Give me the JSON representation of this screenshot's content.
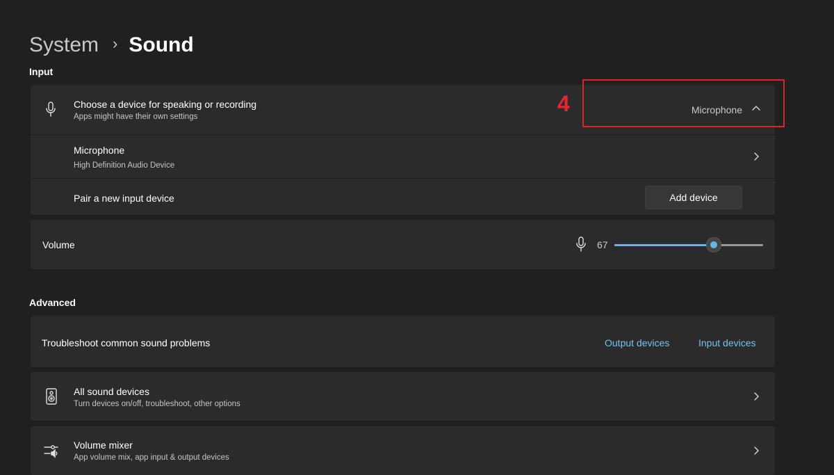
{
  "breadcrumb": {
    "parent": "System",
    "separator": "›",
    "current": "Sound"
  },
  "input_section": {
    "label": "Input",
    "choose_device": {
      "title": "Choose a device for speaking or recording",
      "subtitle": "Apps might have their own settings",
      "selected": "Microphone",
      "icon": "microphone-icon",
      "expanded": true
    },
    "microphone": {
      "title": "Microphone",
      "subtitle": "High Definition Audio Device"
    },
    "pair": {
      "title": "Pair a new input device",
      "button": "Add device"
    },
    "volume": {
      "label": "Volume",
      "value": "67",
      "level": 0.67,
      "icon": "microphone-icon"
    }
  },
  "annotation": {
    "number": "4",
    "color": "#d9262b"
  },
  "advanced_section": {
    "label": "Advanced",
    "troubleshoot": {
      "title": "Troubleshoot common sound problems",
      "link_output": "Output devices",
      "link_input": "Input devices"
    },
    "all_devices": {
      "title": "All sound devices",
      "subtitle": "Turn devices on/off, troubleshoot, other options",
      "icon": "speaker-icon"
    },
    "mixer": {
      "title": "Volume mixer",
      "subtitle": "App volume mix, app input & output devices",
      "icon": "mixer-icon"
    }
  },
  "colors": {
    "background": "#202020",
    "card": "#2b2b2b",
    "accent": "#5fb8e6",
    "link": "#76c3e9"
  }
}
